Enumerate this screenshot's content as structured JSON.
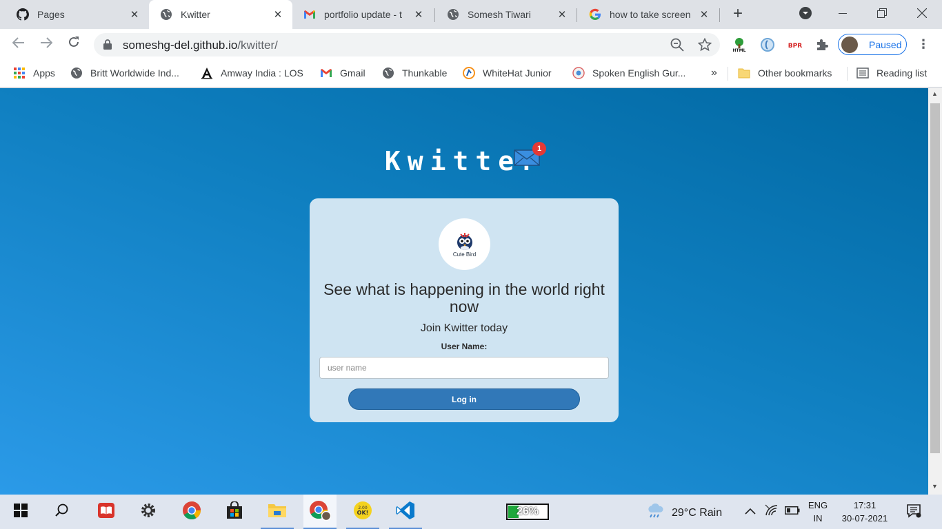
{
  "browser": {
    "tabs": [
      {
        "title": "Pages",
        "icon": "github-icon",
        "active": false
      },
      {
        "title": "Kwitter",
        "icon": "globe-icon",
        "active": true
      },
      {
        "title": "portfolio update - t",
        "icon": "gmail-icon",
        "active": false
      },
      {
        "title": "Somesh Tiwari",
        "icon": "globe-icon",
        "active": false
      },
      {
        "title": "how to take screen",
        "icon": "google-icon",
        "active": false
      }
    ],
    "url_host": "someshg-del.github.io",
    "url_path": "/kwitter/",
    "profile_label": "Paused",
    "bookmarks": [
      {
        "label": "Apps",
        "icon": "apps-grid-icon"
      },
      {
        "label": "Britt Worldwide Ind...",
        "icon": "globe-icon"
      },
      {
        "label": "Amway India : LOS",
        "icon": "amway-icon"
      },
      {
        "label": "Gmail",
        "icon": "gmail-icon"
      },
      {
        "label": "Thunkable",
        "icon": "globe-icon"
      },
      {
        "label": "WhiteHat Junior",
        "icon": "whitehat-icon"
      },
      {
        "label": "Spoken English Gur...",
        "icon": "spoken-english-icon"
      }
    ],
    "bookmarks_overflow": "»",
    "other_bookmarks": "Other bookmarks",
    "reading_list": "Reading list",
    "extensions": [
      "html-tree-icon",
      "extension-ring-icon",
      "bpr-icon",
      "puzzle-icon"
    ]
  },
  "page": {
    "brand_title": "Kwitter",
    "notification_count": "1",
    "logo_text": "Cute Bird",
    "headline": "See what is happening in the world right now",
    "subline": "Join Kwitter today",
    "username_label": "User Name:",
    "username_placeholder": "user name",
    "username_value": "",
    "login_label": "Log in"
  },
  "taskbar": {
    "battery_percent": "26%",
    "battery_level": 0.26,
    "weather": "29°C  Rain",
    "lang_top": "ENG",
    "lang_bottom": "IN",
    "time": "17:31",
    "date": "30-07-2021"
  },
  "colors": {
    "accent": "#1a73e8",
    "page_bg_dark": "#0168a2",
    "page_bg_light": "#2b9ae8",
    "card": "#cfe4f2",
    "login_button": "#3178b8"
  }
}
